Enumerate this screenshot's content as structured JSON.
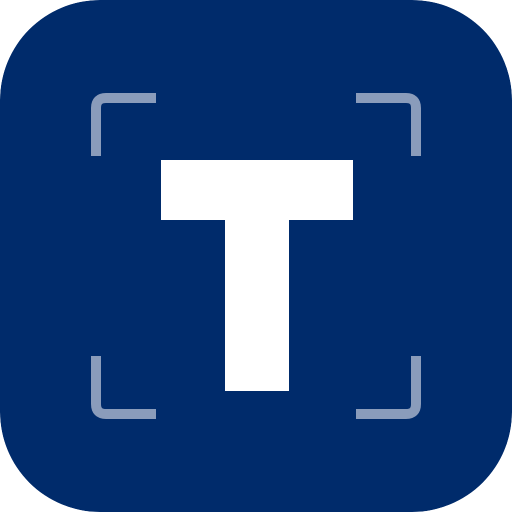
{
  "app_icon": {
    "glyph": "T",
    "icon": "text-scanner-app-icon",
    "colors": {
      "background": "#002b6b",
      "glyph": "#ffffff",
      "frame_corners": "#8a9cbb"
    }
  }
}
